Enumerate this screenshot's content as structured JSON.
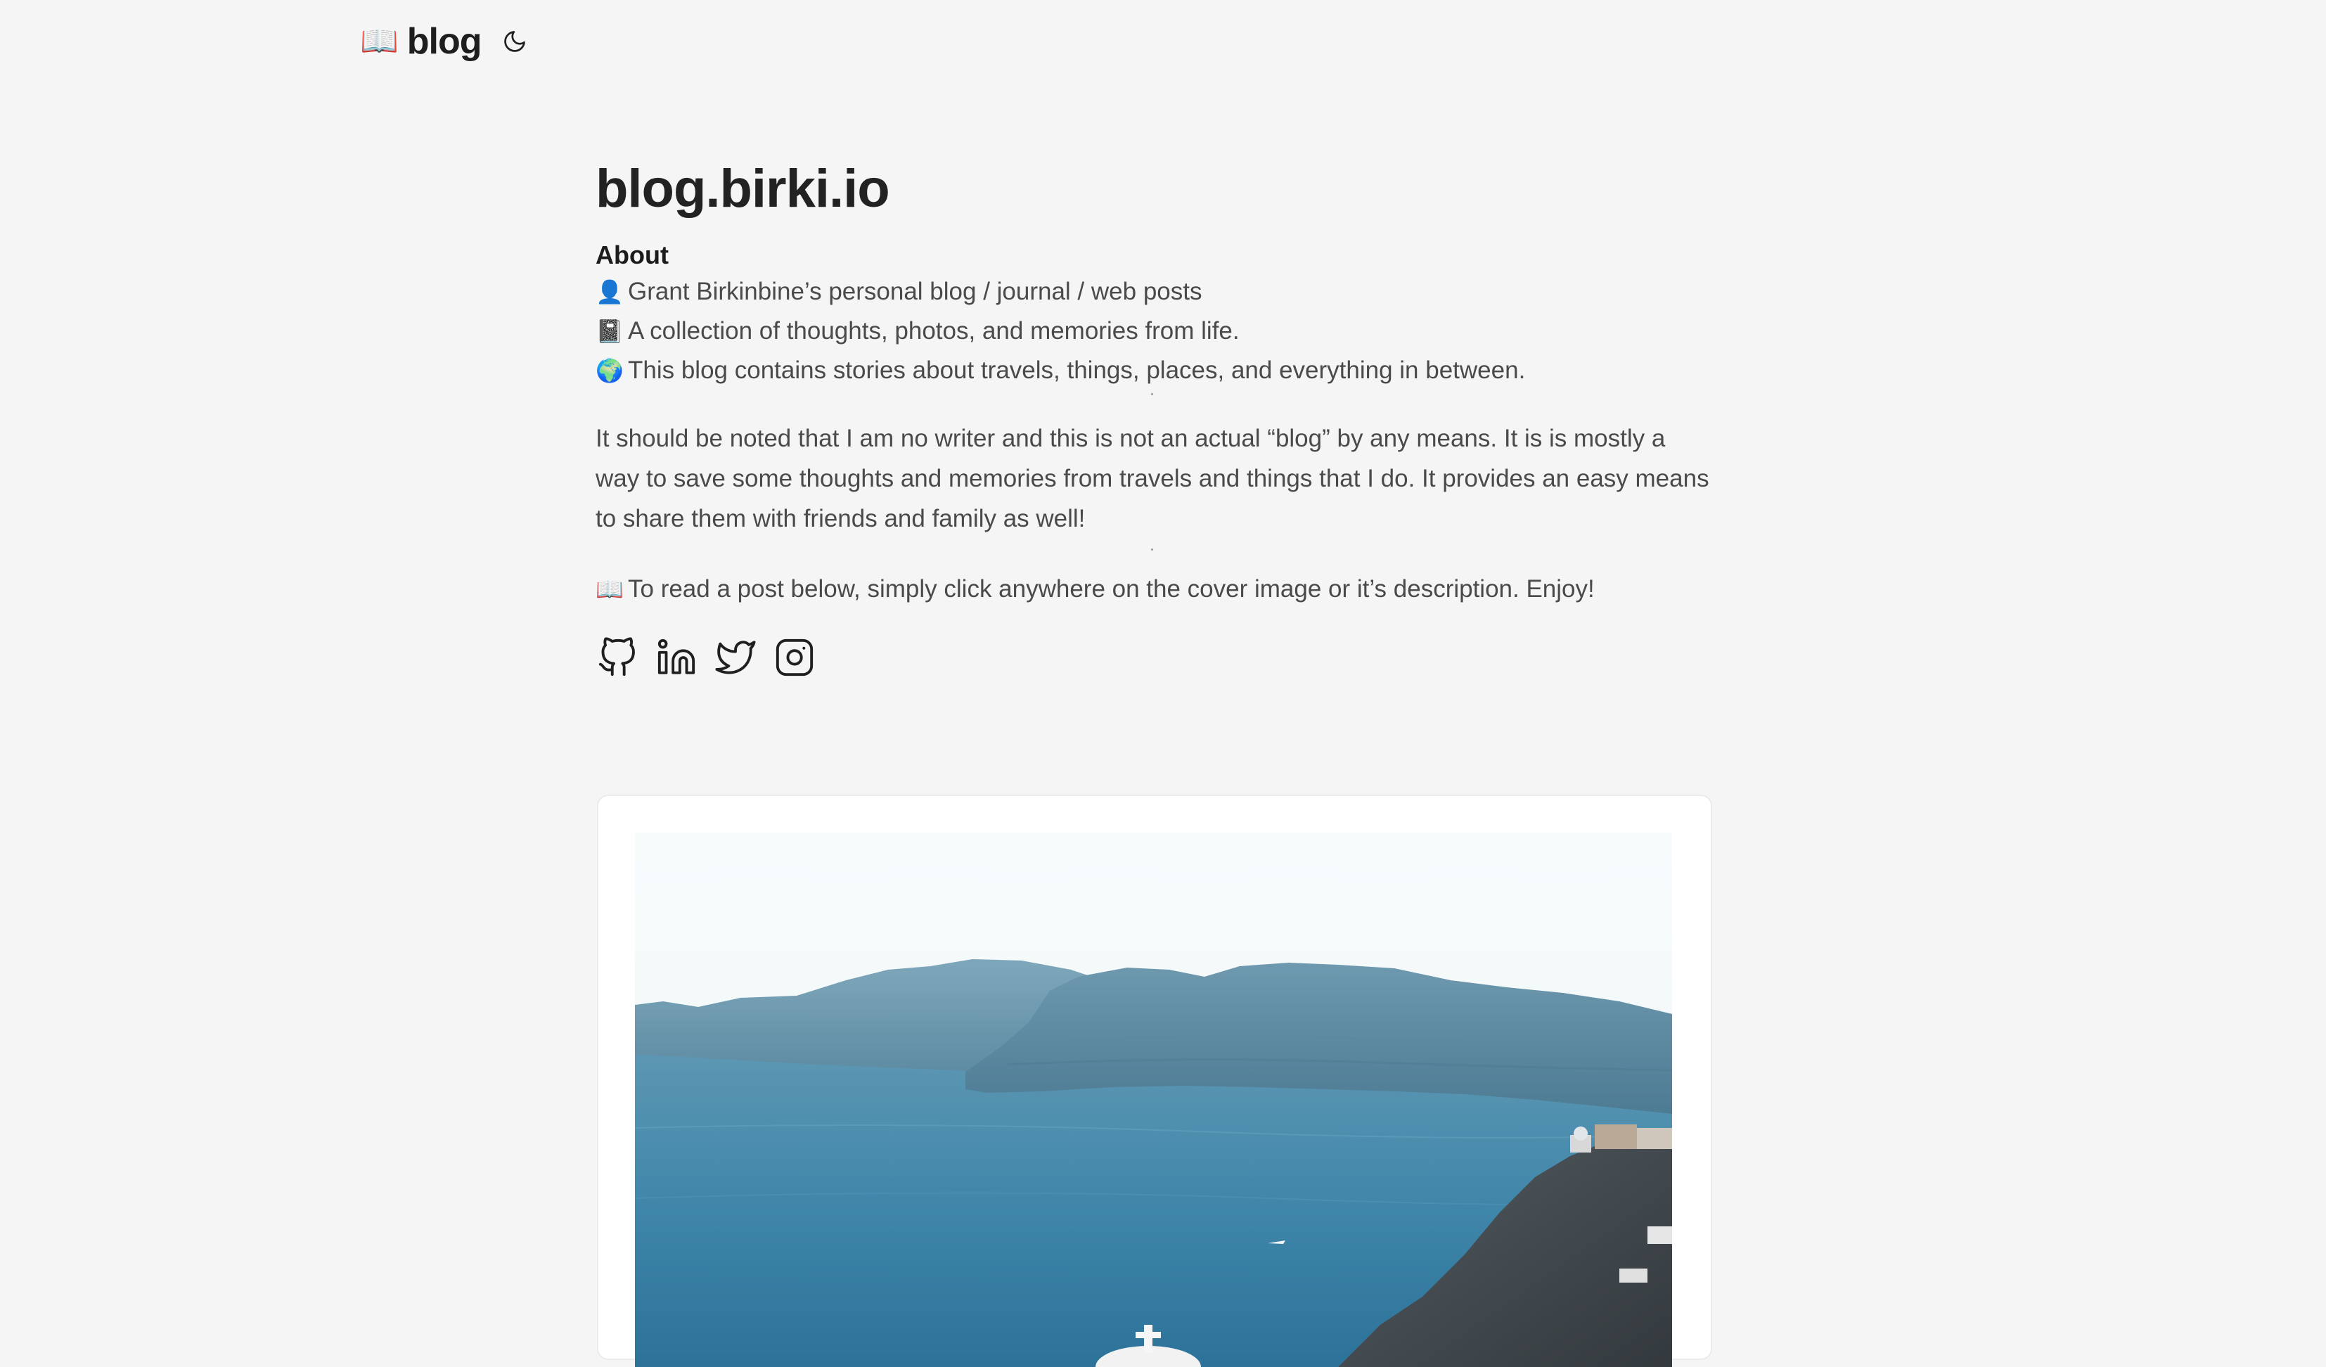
{
  "header": {
    "logo_emoji": "📖",
    "logo_text": "blog",
    "theme_icon": "moon-icon"
  },
  "main": {
    "title": "blog.birki.io",
    "about_heading": "About",
    "about_lines": [
      {
        "emoji": "👤",
        "text": "Grant Birkinbine’s personal blog / journal / web posts"
      },
      {
        "emoji": "📓",
        "text": "A collection of thoughts, photos, and memories from life."
      },
      {
        "emoji": "🌍",
        "text": "This blog contains stories about travels, things, places, and everything in between."
      }
    ],
    "paragraph": "It should be noted that I am no writer and this is not an actual “blog” by any means. It is is mostly a way to save some thoughts and memories from travels and things that I do. It provides an easy means to share them with friends and family as well!",
    "read_emoji": "📖",
    "read_text": "To read a post below, simply click anywhere on the cover image or it’s description. Enjoy!",
    "socials": [
      "github-icon",
      "linkedin-icon",
      "twitter-icon",
      "instagram-icon"
    ]
  },
  "post": {
    "cover_image": "santorini-caldera-photo"
  }
}
